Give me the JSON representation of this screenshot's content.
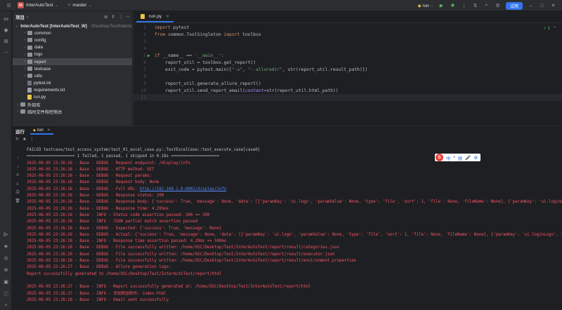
{
  "titlebar": {
    "project_badge": "IA",
    "project_name": "InterAutoTest",
    "branch": "master",
    "run_config": "run",
    "trial_label": "试用"
  },
  "project_panel": {
    "title": "项目",
    "tree": [
      {
        "indent": 0,
        "chev": "⌄",
        "kind": "folder",
        "label": "InterAutoTest [InterAutoTest_W]",
        "dim": "~/Desktop/Test/InterAutoTest"
      },
      {
        "indent": 1,
        "chev": "›",
        "kind": "folder",
        "label": "common",
        "dim": ""
      },
      {
        "indent": 1,
        "chev": "›",
        "kind": "folder",
        "label": "config",
        "dim": ""
      },
      {
        "indent": 1,
        "chev": "›",
        "kind": "folder",
        "label": "data",
        "dim": ""
      },
      {
        "indent": 1,
        "chev": "›",
        "kind": "folder",
        "label": "logs",
        "dim": ""
      },
      {
        "indent": 1,
        "chev": "›",
        "kind": "folder",
        "label": "report",
        "dim": "",
        "selected": true
      },
      {
        "indent": 1,
        "chev": "›",
        "kind": "folder",
        "label": "testcase",
        "dim": ""
      },
      {
        "indent": 1,
        "chev": "›",
        "kind": "folder",
        "label": "utils",
        "dim": ""
      },
      {
        "indent": 1,
        "chev": "",
        "kind": "file",
        "label": "pytest.ini",
        "dim": ""
      },
      {
        "indent": 1,
        "chev": "",
        "kind": "txt",
        "label": "requirements.txt",
        "dim": ""
      },
      {
        "indent": 1,
        "chev": "",
        "kind": "py",
        "label": "run.py",
        "dim": ""
      },
      {
        "indent": 0,
        "chev": "›",
        "kind": "lib",
        "label": "外部库",
        "dim": ""
      },
      {
        "indent": 0,
        "chev": "›",
        "kind": "scratch",
        "label": "临时文件和控制台",
        "dim": ""
      }
    ]
  },
  "editor": {
    "tab_label": "run.py",
    "inspection": "✓ 1",
    "lines": [
      {
        "n": "1",
        "mark": "",
        "segs": [
          [
            "kw",
            "import"
          ],
          [
            "plain",
            " pytest"
          ]
        ]
      },
      {
        "n": "2",
        "mark": "",
        "segs": [
          [
            "kw",
            "from"
          ],
          [
            "plain",
            " common.ToolSingleton "
          ],
          [
            "kw",
            "import"
          ],
          [
            "plain",
            " toolbox"
          ]
        ]
      },
      {
        "n": "3",
        "mark": "",
        "segs": []
      },
      {
        "n": "4",
        "mark": "",
        "segs": []
      },
      {
        "n": "5",
        "mark": "▶",
        "segs": [
          [
            "kw",
            "if"
          ],
          [
            "plain",
            " __name__ == "
          ],
          [
            "str",
            "'__main__'"
          ],
          [
            "plain",
            ":"
          ]
        ]
      },
      {
        "n": "6",
        "mark": "",
        "segs": [
          [
            "plain",
            "    report_util = toolbox.get_report()"
          ]
        ]
      },
      {
        "n": "7",
        "mark": "",
        "segs": [
          [
            "plain",
            "    exit_code = pytest.main(["
          ],
          [
            "str",
            "\"-s\""
          ],
          [
            "plain",
            ", "
          ],
          [
            "str",
            "\"--alluredir\""
          ],
          [
            "plain",
            ", str(report_util.result_path)])"
          ]
        ]
      },
      {
        "n": "8",
        "mark": "",
        "segs": []
      },
      {
        "n": "9",
        "mark": "",
        "segs": [
          [
            "plain",
            "    report_util.generate_allure_report()"
          ]
        ]
      },
      {
        "n": "10",
        "mark": "",
        "segs": [
          [
            "plain",
            "    report_util.send_report_email("
          ],
          [
            "param",
            "content="
          ],
          [
            "plain",
            "str(report_util.html_path))"
          ]
        ]
      },
      {
        "n": "11",
        "mark": "",
        "segs": [],
        "current": true
      }
    ]
  },
  "run_panel": {
    "title": "运行",
    "tab_label": "run",
    "console": [
      {
        "c": "gray",
        "t": "FAILED testcase/test_access_system/test_01_excel_case.py::TestExcelCase::test_execute_case[case0]"
      },
      {
        "c": "gray",
        "t": "==================== 1 failed, 1 passed, 1 skipped in 0.18s ===================="
      },
      {
        "c": "red",
        "t": "2025-06-05 23:26:26 - Base - DEBUG - Request endpoint: /display/info"
      },
      {
        "c": "red",
        "t": "2025-06-05 23:26:26 - Base - DEBUG - HTTP method: GET"
      },
      {
        "c": "red",
        "t": "2025-06-05 23:26:26 - Base - DEBUG - Request params:"
      },
      {
        "c": "red",
        "t": "2025-06-05 23:26:26 - Base - DEBUG - Request body: None"
      },
      {
        "c": "red",
        "t": "2025-06-05 23:26:26 - Base - DEBUG - Full URL: ",
        "link": "http://192.168.1.8:8081/display/info"
      },
      {
        "c": "red",
        "t": "2025-06-05 23:26:26 - Base - DEBUG - Response status: 200"
      },
      {
        "c": "red",
        "t": "2025-06-05 23:26:26 - Base - DEBUG - Response body: {'success': True, 'message': None, 'data': [{'paramKey': 'ui.logo', 'paramValue': None, 'type': 'file', 'sort': 1, 'file': None, 'fileName': None}, {'paramKey': 'ui.loginLo"
      },
      {
        "c": "red",
        "t": "2025-06-05 23:26:26 - Base - DEBUG - Response time: 4.295ms"
      },
      {
        "c": "red",
        "t": "2025-06-05 23:26:26 - Base - INFO - Status code assertion passed: 200 == 200"
      },
      {
        "c": "red",
        "t": "2025-06-05 23:26:26 - Base - INFO - JSON partial match assertion passed"
      },
      {
        "c": "red",
        "t": "2025-06-05 23:26:26 - Base - DEBUG - Expected: {'success': True, 'message': None}"
      },
      {
        "c": "red",
        "t": "2025-06-05 23:26:26 - Base - DEBUG - Actual: {'success': True, 'message': None, 'data': [{'paramKey': 'ui.logo', 'paramValue': None, 'type': 'file', 'sort': 1, 'file': None, 'fileName': None}, {'paramKey': 'ui.loginLogo', 'p"
      },
      {
        "c": "red",
        "t": "2025-06-05 23:26:26 - Base - INFO - Response time assertion passed: 4.29ms <= 500ms"
      },
      {
        "c": "red",
        "t": "2025-06-05 23:26:26 - Base - DEBUG - File successfully written: /home/OSC/Desktop/Test/InterAutoTest/report/result/categories.json"
      },
      {
        "c": "red",
        "t": "2025-06-05 23:26:26 - Base - DEBUG - File successfully written: /home/OSC/Desktop/Test/InterAutoTest/report/result/executor.json"
      },
      {
        "c": "red",
        "t": "2025-06-05 23:26:26 - Base - DEBUG - File successfully written: /home/OSC/Desktop/Test/InterAutoTest/report/result/environment.properties"
      },
      {
        "c": "red",
        "t": "2025-06-05 23:26:27 - Base - DEBUG - Allure generation logs:"
      },
      {
        "c": "red",
        "t": "Report successfully generated to /home/OSC/Desktop/Test/InterAutoTest/report/html"
      },
      {
        "c": "red",
        "t": ""
      },
      {
        "c": "red",
        "t": "2025-06-05 23:26:27 - Base - INFO - Report successfully generated at: /home/OSC/Desktop/Test/InterAutoTest/report/html"
      },
      {
        "c": "red",
        "t": "2025-06-05 23:26:27 - Base - INFO - 添加附加附件: index.html"
      },
      {
        "c": "red",
        "t": "2025-06-05 23:26:28 - Base - INFO - Email sent successfully"
      }
    ]
  },
  "ime": {
    "logo": "S",
    "items": [
      "中",
      "•",
      "拼",
      "🎤",
      "⚙"
    ]
  },
  "colors": {
    "accent": "#3574f0",
    "error_text": "#f75464",
    "link": "#548af7"
  }
}
